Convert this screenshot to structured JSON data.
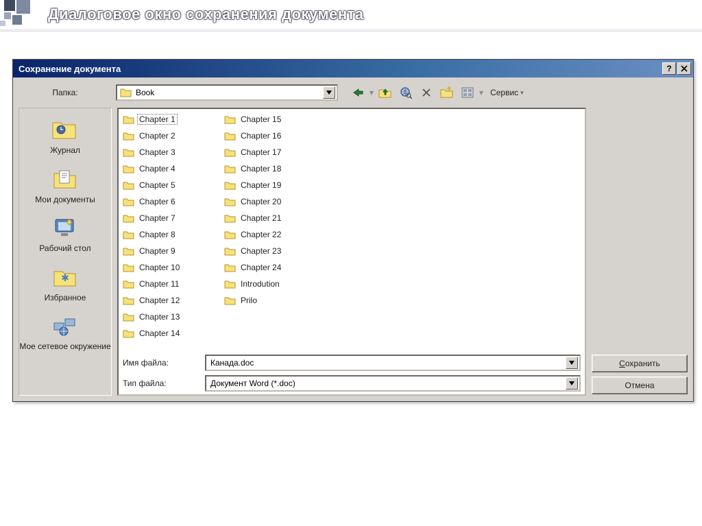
{
  "slide_title": "Диалоговое окно сохранения документа",
  "dialog": {
    "title": "Сохранение документа",
    "folder_label": "Папка:",
    "current_folder": "Book",
    "tools_label": "Сервис",
    "places": [
      {
        "label": "Журнал"
      },
      {
        "label": "Мои документы"
      },
      {
        "label": "Рабочий стол"
      },
      {
        "label": "Избранное"
      },
      {
        "label": "Мое сетевое окружение"
      }
    ],
    "files": [
      "Chapter 1",
      "Chapter 2",
      "Chapter 3",
      "Chapter 4",
      "Chapter 5",
      "Chapter 6",
      "Chapter 7",
      "Chapter 8",
      "Chapter 9",
      "Chapter 10",
      "Chapter 11",
      "Chapter 12",
      "Chapter 13",
      "Chapter 14",
      "Chapter 15",
      "Chapter 16",
      "Chapter 17",
      "Chapter 18",
      "Chapter 19",
      "Chapter 20",
      "Chapter 21",
      "Chapter 22",
      "Chapter 23",
      "Chapter 24",
      "Introdution",
      "Prilo"
    ],
    "filename_label": "Имя файла:",
    "filetype_label": "Тип файла:",
    "filename_value": "Канада.doc",
    "filetype_value": "Документ Word (*.doc)",
    "save_label": "Сохранить",
    "cancel_label": "Отмена"
  }
}
